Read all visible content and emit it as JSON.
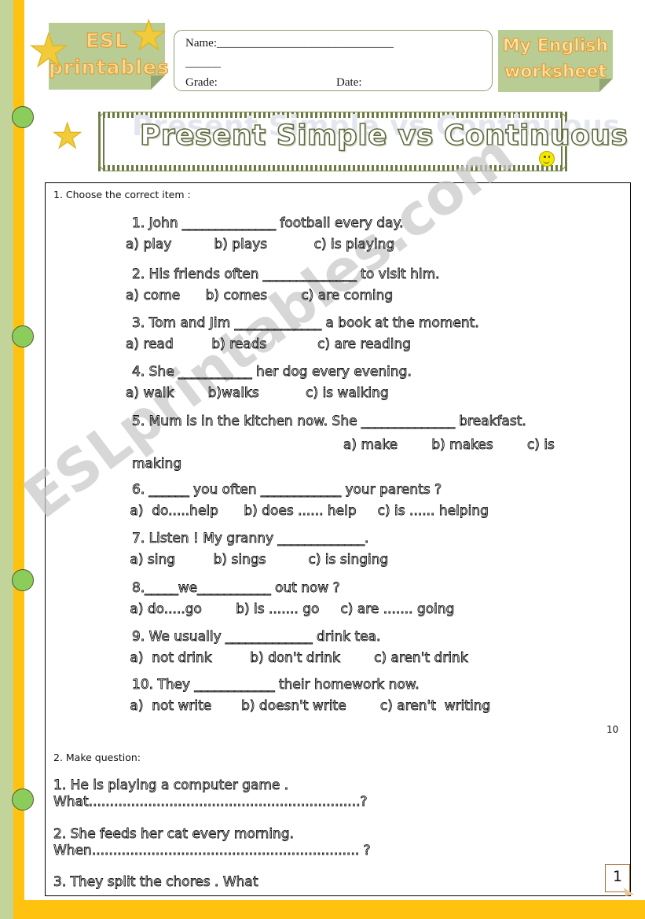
{
  "branding": {
    "logo_line1": "ESL",
    "logo_line2": "printables",
    "badge_line1": "My English",
    "badge_line2": "worksheet",
    "watermark": "ESLprintables.com",
    "logo_bg_color": "#b9cc94",
    "logo_text_color": "#e8941c",
    "accent_orange": "#ffc20e",
    "accent_green": "#8ccc5a"
  },
  "student_fields": {
    "name_label": "Name:______________________________",
    "name_label_cont": "______",
    "grade_label": "Grade:",
    "date_label": "Date:"
  },
  "title": {
    "text": "Present Simple vs Continuous",
    "ghost_text": "Present Simple vs Continuous",
    "smiley": "smiley-face"
  },
  "exercise1": {
    "heading": "1.   Choose the correct item :",
    "score": "10",
    "questions": [
      {
        "stem": "1. John  ______________ football every day.",
        "options": "a) play          b) plays           c) is playing"
      },
      {
        "stem": "2. His friends often ______________ to visit him.",
        "options": "a) come      b) comes        c) are coming"
      },
      {
        "stem": "3. Tom and Jim _____________ a book at the moment.",
        "options": "a) read         b) reads            c) are reading"
      },
      {
        "stem": "4. She ___________ her dog every evening.",
        "options": "a) walk        b)walks           c) is walking"
      },
      {
        "stem": "5. Mum is in the kitchen now. She ______________ breakfast.",
        "options": "a) make        b) makes        c) is",
        "wrap": "making"
      },
      {
        "stem": "6. ______ you often ____________ your parents ?",
        "options": " a)  do.....help      b) does ...... help     c) is ...... helping"
      },
      {
        "stem": "7.  Listen ! My granny _____________.",
        "options": " a) sing         b) sings          c) is singing"
      },
      {
        "stem": "8._____we___________ out now ?",
        "options": " a) do.....go        b) is ....... go     c) are ....... going"
      },
      {
        "stem": "9. We usually _____________ drink tea.",
        "options": " a)  not drink         b) don't drink        c) aren't drink"
      },
      {
        "stem": "10. They ____________ their homework now.",
        "options": " a)  not write       b) doesn't write        c) aren't  writing"
      }
    ]
  },
  "exercise2": {
    "heading": "2. Make question:",
    "items": [
      {
        "prompt": "1.  He is playing a computer game .",
        "answer_line": "What................................................................?"
      },
      {
        "prompt": "2. She feeds her cat every morning.",
        "answer_line": "When...............................................................  ?"
      },
      {
        "prompt": "3. They split the chores . What",
        "answer_line": ""
      }
    ]
  },
  "footer": {
    "page_number": "1"
  }
}
